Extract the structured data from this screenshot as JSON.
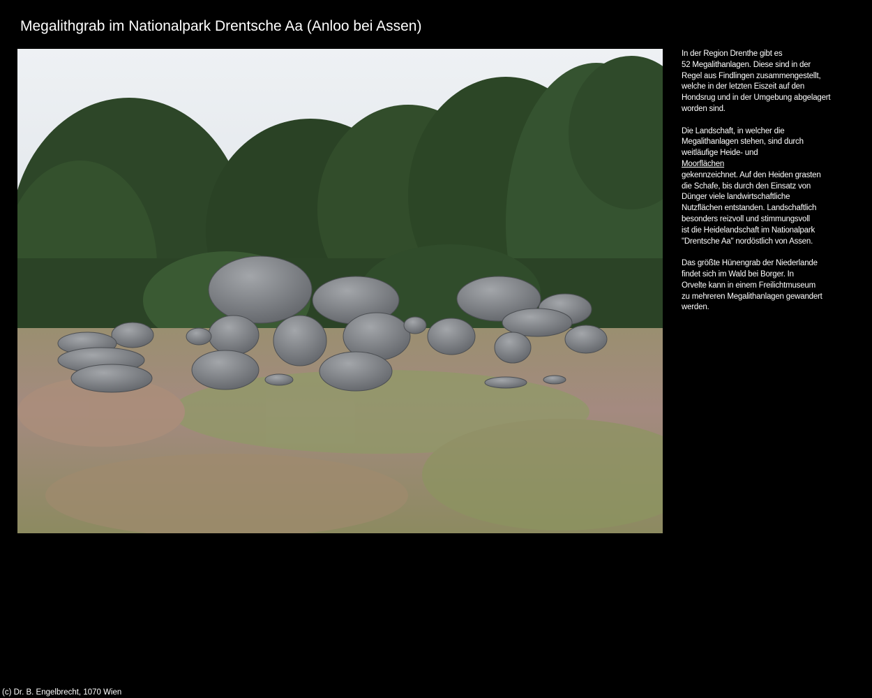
{
  "page": {
    "title": "Megalithgrab im Nationalpark Drentsche Aa (Anloo bei Assen)"
  },
  "photo": {
    "alt": "Megalithgrab im Nationalpark Drentsche Aa"
  },
  "description": {
    "paragraph_1": [
      "In der Region Drenthe gibt es",
      "52 Megalithanlagen. Diese sind in der",
      "Regel aus Findlingen zusammengestellt,",
      "welche in der letzten Eiszeit auf den",
      "Hondsrug und in der Umgebung abgelagert",
      "worden sind."
    ],
    "paragraph_2_before_link": [
      "Die Landschaft, in welcher die",
      "Megalithanlagen stehen, sind durch",
      "weitläufige Heide- und"
    ],
    "paragraph_2_link": "Moorflächen",
    "paragraph_2_after_link": [
      "gekennzeichnet. Auf den Heiden grasten",
      "die Schafe, bis durch den Einsatz von",
      "Dünger viele landwirtschaftliche",
      "Nutzflächen entstanden. Landschaftlich",
      "besonders reizvoll und stimmungsvoll",
      "ist die Heidelandschaft im Nationalpark",
      "\"Drentsche Aa\" nordöstlich von Assen."
    ],
    "paragraph_3": [
      "Das größte Hünengrab der Niederlande",
      "findet sich im Wald bei Borger. In",
      "Orvelte kann in einem Freilichtmuseum",
      "zu mehreren Megalithanlagen gewandert",
      "werden."
    ]
  },
  "footer": {
    "copyright": "(c) Dr. B. Engelbrecht, 1070 Wien"
  },
  "colors": {
    "background": "#000000",
    "text": "#ffffff",
    "sky": "#dfe4ea",
    "trees": "#2f4a2a",
    "stone": "#7d7f83",
    "grass": "#8e8a66"
  }
}
